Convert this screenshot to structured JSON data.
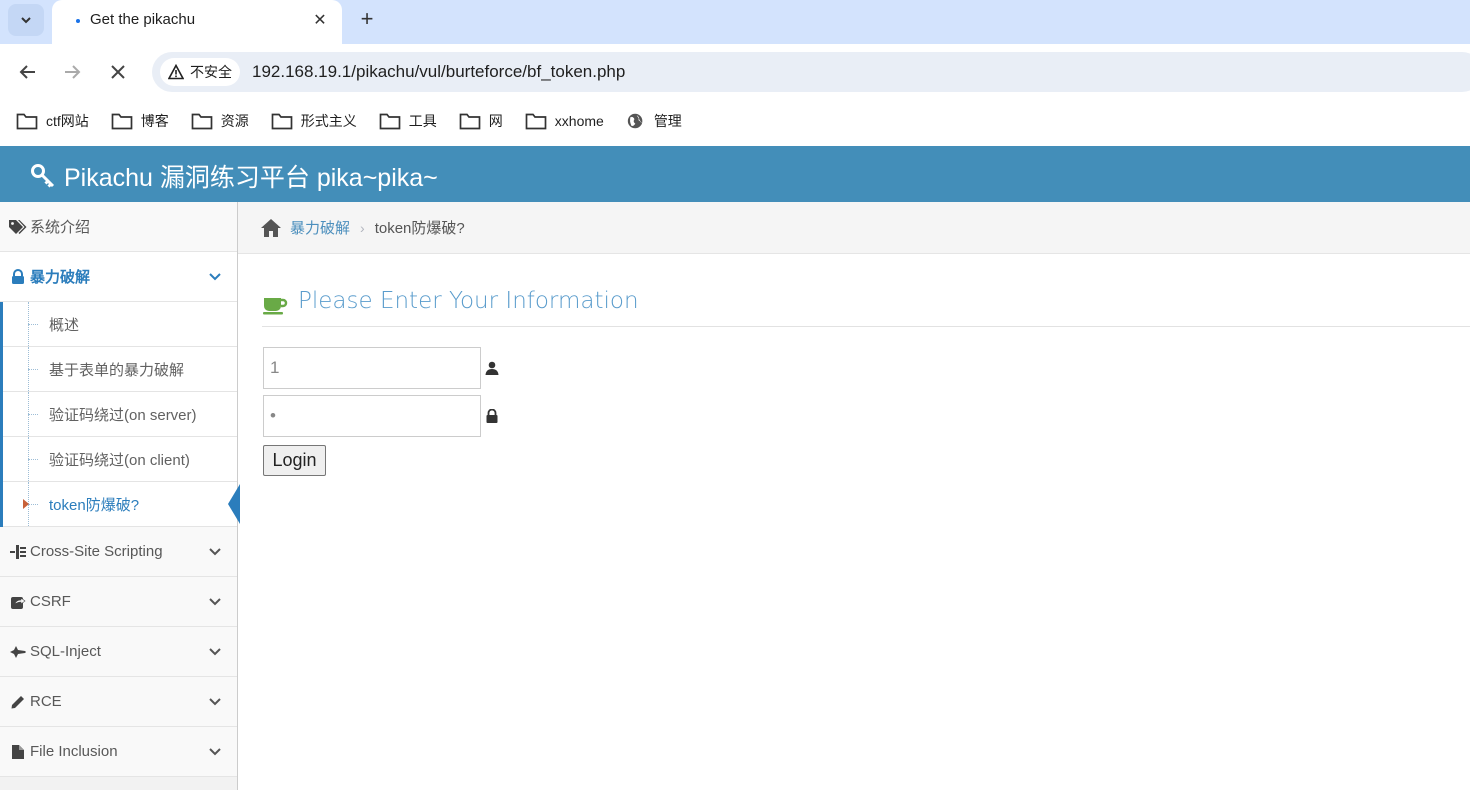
{
  "browser": {
    "tab_title": "Get the pikachu",
    "security_label": "不安全",
    "url": "192.168.19.1/pikachu/vul/burteforce/bf_token.php",
    "bookmarks": [
      {
        "label": "ctf网站",
        "icon": "folder-icon"
      },
      {
        "label": "博客",
        "icon": "folder-icon"
      },
      {
        "label": "资源",
        "icon": "folder-icon"
      },
      {
        "label": "形式主义",
        "icon": "folder-icon"
      },
      {
        "label": "工具",
        "icon": "folder-icon"
      },
      {
        "label": "网",
        "icon": "folder-icon"
      },
      {
        "label": "xxhome",
        "icon": "folder-icon"
      },
      {
        "label": "管理",
        "icon": "globe-icon"
      }
    ]
  },
  "header": {
    "title": "Pikachu 漏洞练习平台 pika~pika~",
    "color": "#438eb9"
  },
  "sidebar": {
    "intro": "系统介绍",
    "brute_force": {
      "label": "暴力破解",
      "items": [
        "概述",
        "基于表单的暴力破解",
        "验证码绕过(on server)",
        "验证码绕过(on client)",
        "token防爆破?"
      ]
    },
    "sections": [
      {
        "label": "Cross-Site Scripting"
      },
      {
        "label": "CSRF"
      },
      {
        "label": "SQL-Inject"
      },
      {
        "label": "RCE"
      },
      {
        "label": "File Inclusion"
      }
    ]
  },
  "breadcrumb": {
    "parent": "暴力破解",
    "current": "token防爆破?"
  },
  "form": {
    "heading": "Please Enter Your Information",
    "username_value": "1",
    "password_value": "•",
    "login_label": "Login"
  },
  "colors": {
    "accent": "#2b7dbc",
    "link": "#4c8fbd",
    "caret": "#c86139",
    "cup": "#69aa46"
  }
}
